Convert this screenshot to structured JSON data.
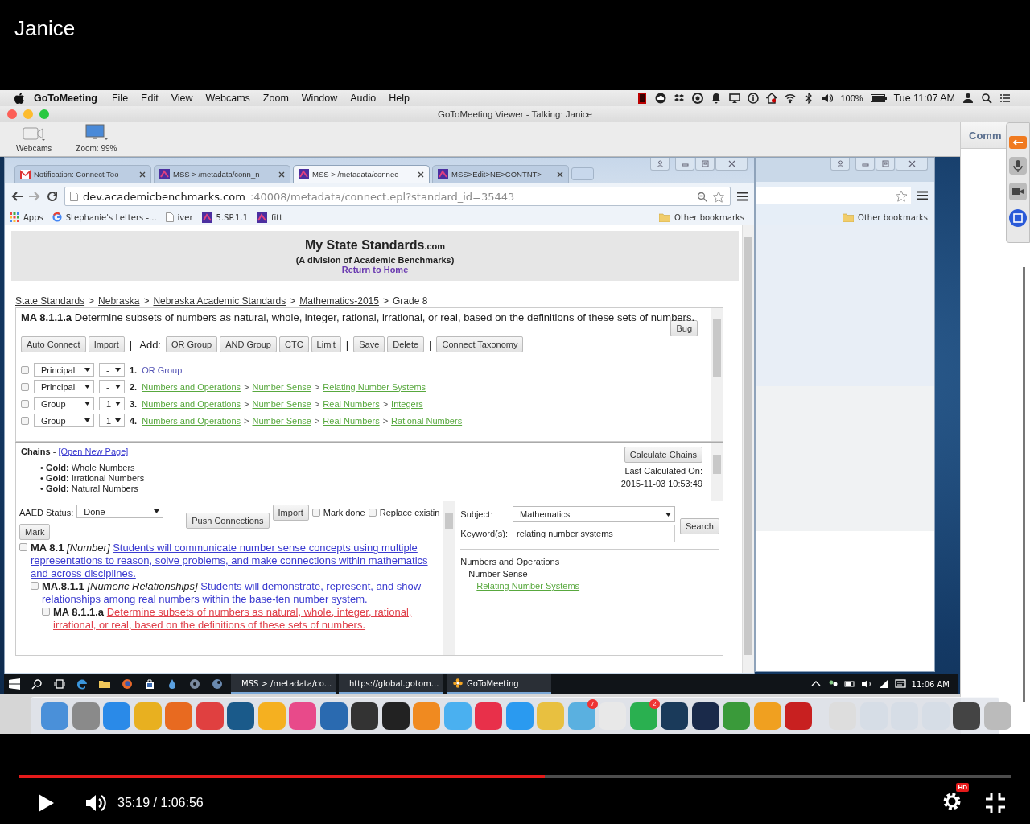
{
  "video": {
    "title": "Janice",
    "progress": {
      "level": 0.53
    },
    "time": "35:19 / 1:06:56",
    "hd_badge": "HD"
  },
  "menubar": {
    "app": "GoToMeeting",
    "menus": [
      "File",
      "Edit",
      "View",
      "Webcams",
      "Zoom",
      "Window",
      "Audio",
      "Help"
    ],
    "battery": "100%",
    "clock": "Tue 11:07 AM"
  },
  "viewer": {
    "title": "GoToMeeting Viewer - Talking: Janice",
    "tools": [
      {
        "kind": "webcam",
        "label": "Webcams"
      },
      {
        "kind": "monitor",
        "label": "Zoom: 99%"
      }
    ],
    "side_tab": "Comm"
  },
  "browser": {
    "tabs": [
      {
        "kind": "mail",
        "label": "Notification: Connect Too",
        "selected": false
      },
      {
        "kind": "site",
        "label": "MSS > /metadata/conn_n",
        "selected": false
      },
      {
        "kind": "site",
        "label": "MSS > /metadata/connec",
        "selected": true
      },
      {
        "kind": "site",
        "label": "MSS>Edit>NE>CONTNT>",
        "selected": false
      }
    ],
    "url_host": "dev.academicbenchmarks.com",
    "url_path": ":40008/metadata/connect.epl?standard_id=35443",
    "bookmarks": [
      {
        "kind": "apps",
        "label": "Apps"
      },
      {
        "kind": "google",
        "label": "Stephanie's Letters -..."
      },
      {
        "kind": "page",
        "label": "iver"
      },
      {
        "kind": "site",
        "label": "5.SP.1.1"
      },
      {
        "kind": "site",
        "label": "fitt"
      }
    ],
    "other_bookmarks": "Other bookmarks"
  },
  "page": {
    "site_title": "My State Standards",
    "site_suffix": ".com",
    "subtitle": "(A division of Academic Benchmarks)",
    "home_link": "Return to Home",
    "breadcrumb": [
      {
        "kind": "link",
        "label": "State Standards"
      },
      {
        "kind": "sep",
        "label": ">"
      },
      {
        "kind": "link",
        "label": "Nebraska"
      },
      {
        "kind": "sep",
        "label": ">"
      },
      {
        "kind": "link",
        "label": "Nebraska Academic Standards"
      },
      {
        "kind": "sep",
        "label": ">"
      },
      {
        "kind": "link",
        "label": "Mathematics-2015"
      },
      {
        "kind": "sep",
        "label": ">"
      },
      {
        "kind": "text",
        "label": "Grade 8"
      }
    ],
    "standard": {
      "code": "MA 8.1.1.a",
      "text": "Determine subsets of numbers as natural, whole, integer, rational, irrational, or real, based on the definitions of these sets of numbers.",
      "bug_button": "Bug"
    },
    "actions": [
      {
        "kind": "button",
        "label": "Auto Connect"
      },
      {
        "kind": "button",
        "label": "Import"
      },
      {
        "kind": "sep",
        "label": "|"
      },
      {
        "kind": "text",
        "label": "Add:"
      },
      {
        "kind": "button",
        "label": "OR Group"
      },
      {
        "kind": "button",
        "label": "AND Group"
      },
      {
        "kind": "button",
        "label": "CTC"
      },
      {
        "kind": "button",
        "label": "Limit"
      },
      {
        "kind": "sep",
        "label": "|"
      },
      {
        "kind": "button",
        "label": "Save"
      },
      {
        "kind": "button",
        "label": "Delete"
      },
      {
        "kind": "sep",
        "label": "|"
      },
      {
        "kind": "button",
        "label": "Connect Taxonomy"
      }
    ],
    "connections": [
      {
        "checked": false,
        "role": "Principal",
        "weight": "-",
        "number": "1.",
        "path": [
          {
            "kind": "group",
            "label": "OR Group"
          }
        ]
      },
      {
        "checked": false,
        "role": "Principal",
        "weight": "-",
        "number": "2.",
        "path": [
          {
            "kind": "link",
            "label": "Numbers and Operations"
          },
          {
            "kind": "sep",
            "label": ">"
          },
          {
            "kind": "link",
            "label": "Number Sense"
          },
          {
            "kind": "sep",
            "label": ">"
          },
          {
            "kind": "link",
            "label": "Relating Number Systems"
          }
        ]
      },
      {
        "checked": false,
        "role": "Group",
        "weight": "1",
        "number": "3.",
        "path": [
          {
            "kind": "link",
            "label": "Numbers and Operations"
          },
          {
            "kind": "sep",
            "label": ">"
          },
          {
            "kind": "link",
            "label": "Number Sense"
          },
          {
            "kind": "sep",
            "label": ">"
          },
          {
            "kind": "link",
            "label": "Real Numbers"
          },
          {
            "kind": "sep",
            "label": ">"
          },
          {
            "kind": "link",
            "label": "Integers"
          }
        ]
      },
      {
        "checked": false,
        "role": "Group",
        "weight": "1",
        "number": "4.",
        "path": [
          {
            "kind": "link",
            "label": "Numbers and Operations"
          },
          {
            "kind": "sep",
            "label": ">"
          },
          {
            "kind": "link",
            "label": "Number Sense"
          },
          {
            "kind": "sep",
            "label": ">"
          },
          {
            "kind": "link",
            "label": "Real Numbers"
          },
          {
            "kind": "sep",
            "label": ">"
          },
          {
            "kind": "link",
            "label": "Rational Numbers"
          }
        ]
      }
    ],
    "chains": {
      "title": "Chains",
      "dash": "-",
      "link": "[Open New Page]",
      "items": [
        {
          "bullet": "•",
          "label": "Gold:",
          "value": "Whole Numbers"
        },
        {
          "bullet": "•",
          "label": "Gold:",
          "value": "Irrational Numbers"
        },
        {
          "bullet": "•",
          "label": "Gold:",
          "value": "Natural Numbers"
        }
      ],
      "calculate_button": "Calculate Chains",
      "last_calculated_label": "Last Calculated On:",
      "last_calculated": "2015-11-03 10:53:49"
    },
    "aaed": {
      "status_label": "AAED Status:",
      "status": "Done",
      "mark_button": "Mark",
      "push_button": "Push Connections",
      "import_button": "Import",
      "mark_done": {
        "label": "Mark done",
        "checked": false
      },
      "replace": {
        "label": "Replace existin",
        "checked": false
      },
      "tree": [
        {
          "code": "MA 8.1",
          "category": "[Number]",
          "text": "Students will communicate number sense concepts using multiple representations to reason, solve problems, and make connections within mathematics and across disciplines.",
          "kind": "normal",
          "checked": false,
          "children": [
            {
              "code": "MA.8.1.1",
              "category": "[Numeric Relationships]",
              "text": "Students will demonstrate, represent, and show relationships among real numbers within the base-ten number system.",
              "kind": "normal",
              "checked": false,
              "children": [
                {
                  "code": "MA 8.1.1.a",
                  "text": "Determine subsets of numbers as natural, whole, integer, rational, irrational, or real, based on the definitions of these sets of numbers.",
                  "kind": "current",
                  "checked": false
                }
              ]
            }
          ]
        }
      ]
    },
    "search": {
      "subject_label": "Subject:",
      "subject": "Mathematics",
      "keyword_label": "Keyword(s):",
      "keyword": "relating number systems",
      "search_button": "Search",
      "results": [
        {
          "kind": "text",
          "label": "Numbers and Operations",
          "children": [
            {
              "kind": "text",
              "label": "Number Sense",
              "children": [
                {
                  "kind": "link",
                  "label": "Relating Number Systems"
                }
              ]
            }
          ]
        }
      ]
    }
  },
  "second_browser": {
    "other_bookmarks": "Other bookmarks"
  },
  "taskbar": {
    "items": [
      {
        "kind": "chrome",
        "label": "MSS > /metadata/co..."
      },
      {
        "kind": "chrome",
        "label": "https://global.gotom..."
      },
      {
        "kind": "flower",
        "label": "GoToMeeting"
      }
    ],
    "clock": "11:06 AM"
  },
  "dock": {
    "apps": [
      {
        "color": "#4a90d9"
      },
      {
        "color": "#8a8a8a"
      },
      {
        "color": "#2a8ae8"
      },
      {
        "color": "#e8b020"
      },
      {
        "color": "#e86a20"
      },
      {
        "color": "#e04040"
      },
      {
        "color": "#1a5a8a"
      },
      {
        "color": "#f5b020"
      },
      {
        "color": "#e84a8a"
      },
      {
        "color": "#2a6ab0"
      },
      {
        "color": "#333333"
      },
      {
        "color": "#222222"
      },
      {
        "color": "#f08a20"
      },
      {
        "color": "#4ab0f0"
      },
      {
        "color": "#e8304a"
      },
      {
        "color": "#2a9af0"
      },
      {
        "color": "#e8c040"
      },
      {
        "color": "#5ab0e0",
        "badge": "7"
      },
      {
        "color": "#e8e8e8"
      },
      {
        "color": "#2ab050",
        "badge": "2"
      },
      {
        "color": "#1a3a5a"
      },
      {
        "color": "#1a2a4a"
      },
      {
        "color": "#3a9a3a"
      },
      {
        "color": "#f0a020"
      },
      {
        "color": "#c82020"
      },
      {
        "color": "#dddddd"
      },
      {
        "color": "#d6dde6"
      },
      {
        "color": "#d6dde6"
      },
      {
        "color": "#d6dde6"
      },
      {
        "color": "#444444"
      },
      {
        "color": "#bbbbbb"
      }
    ]
  }
}
